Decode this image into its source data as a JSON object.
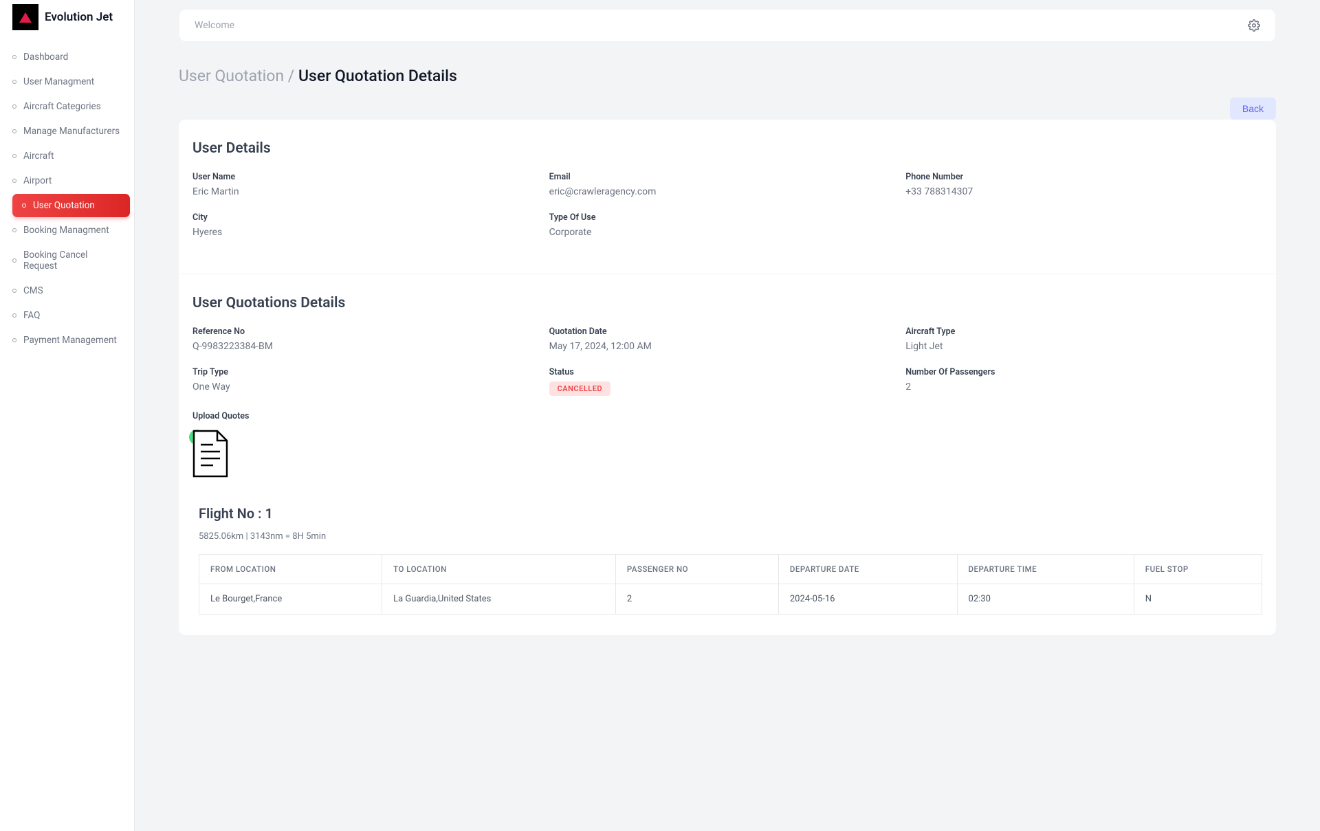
{
  "app": {
    "name": "Evolution Jet"
  },
  "topbar": {
    "welcome": "Welcome"
  },
  "sidebar": {
    "items": [
      {
        "label": "Dashboard"
      },
      {
        "label": "User Managment"
      },
      {
        "label": "Aircraft Categories"
      },
      {
        "label": "Manage Manufacturers"
      },
      {
        "label": "Aircraft"
      },
      {
        "label": "Airport"
      },
      {
        "label": "User Quotation"
      },
      {
        "label": "Booking Managment"
      },
      {
        "label": "Booking Cancel Request"
      },
      {
        "label": "CMS"
      },
      {
        "label": "FAQ"
      },
      {
        "label": "Payment Management"
      }
    ],
    "active_index": 6
  },
  "breadcrumb": {
    "parent": "User Quotation",
    "separator": " / ",
    "current": "User Quotation Details"
  },
  "actions": {
    "back": "Back"
  },
  "user_details": {
    "title": "User Details",
    "fields": {
      "user_name": {
        "label": "User Name",
        "value": "Eric Martin"
      },
      "email": {
        "label": "Email",
        "value": "eric@crawleragency.com"
      },
      "phone_number": {
        "label": "Phone Number",
        "value": "+33 788314307"
      },
      "city": {
        "label": "City",
        "value": "Hyeres"
      },
      "type_of_use": {
        "label": "Type Of Use",
        "value": "Corporate"
      }
    }
  },
  "quotation_details": {
    "title": "User Quotations Details",
    "fields": {
      "reference_no": {
        "label": "Reference No",
        "value": "Q-9983223384-BM"
      },
      "quotation_date": {
        "label": "Quotation Date",
        "value": "May 17, 2024, 12:00 AM"
      },
      "aircraft_type": {
        "label": "Aircraft Type",
        "value": "Light Jet"
      },
      "trip_type": {
        "label": "Trip Type",
        "value": "One Way"
      },
      "status": {
        "label": "Status",
        "value": "CANCELLED"
      },
      "number_of_passengers": {
        "label": "Number Of Passengers",
        "value": "2"
      },
      "upload_quotes": {
        "label": "Upload Quotes"
      }
    },
    "flight": {
      "title": "Flight No : 1",
      "subtitle": "5825.06km | 3143nm = 8H 5min",
      "columns": {
        "from_location": "FROM LOCATION",
        "to_location": "TO LOCATION",
        "passenger_no": "PASSENGER NO",
        "departure_date": "DEPARTURE DATE",
        "departure_time": "DEPARTURE TIME",
        "fuel_stop": "FUEL STOP"
      },
      "row": {
        "from_location": "Le Bourget,France",
        "to_location": "La Guardia,United States",
        "passenger_no": "2",
        "departure_date": "2024-05-16",
        "departure_time": "02:30",
        "fuel_stop": "N"
      }
    }
  }
}
